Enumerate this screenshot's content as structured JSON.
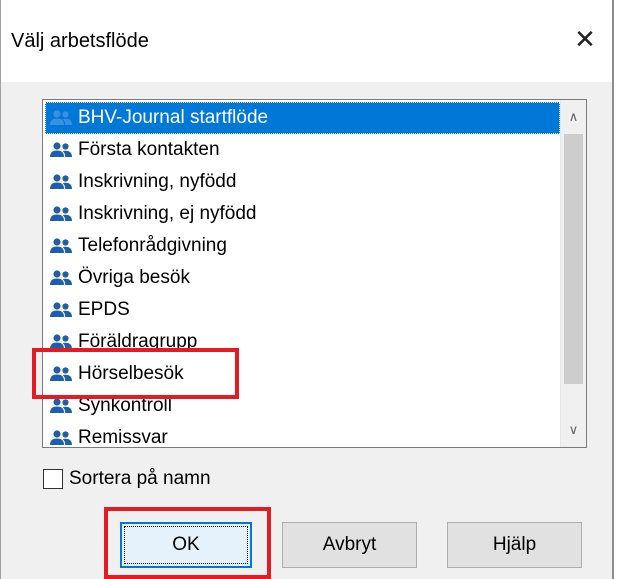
{
  "window": {
    "title": "Välj arbetsflöde",
    "close_symbol": "✕"
  },
  "list": {
    "items": [
      {
        "label": "BHV-Journal startflöde",
        "icon": "users-icon",
        "selected": true
      },
      {
        "label": "Första kontakten",
        "icon": "users-icon",
        "selected": false
      },
      {
        "label": "Inskrivning, nyfödd",
        "icon": "users-icon",
        "selected": false
      },
      {
        "label": "Inskrivning, ej nyfödd",
        "icon": "users-icon",
        "selected": false
      },
      {
        "label": "Telefonrådgivning",
        "icon": "users-icon",
        "selected": false
      },
      {
        "label": "Övriga besök",
        "icon": "users-icon",
        "selected": false
      },
      {
        "label": "EPDS",
        "icon": "users-icon",
        "selected": false
      },
      {
        "label": "Föräldragrupp",
        "icon": "users-icon",
        "selected": false
      },
      {
        "label": "Hörselbesök",
        "icon": "users-icon",
        "selected": false
      },
      {
        "label": "Synkontroll",
        "icon": "users-icon",
        "selected": false
      },
      {
        "label": "Remissvar",
        "icon": "users-icon",
        "selected": false
      }
    ],
    "scroll_up_symbol": "∧",
    "scroll_down_symbol": "∨"
  },
  "options": {
    "sort_by_name_label": "Sortera på namn",
    "sort_by_name_checked": false
  },
  "buttons": {
    "ok_label": "OK",
    "cancel_label": "Avbryt",
    "help_label": "Hjälp"
  },
  "colors": {
    "selection": "#0078d7",
    "icon": "#1f5fa8",
    "highlight": "#e31c23"
  }
}
